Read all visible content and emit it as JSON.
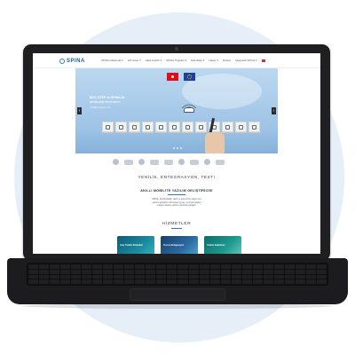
{
  "site": {
    "logo_text": "SPINA",
    "brand_color": "#1b5f9c",
    "accent_color": "#2a7fc4",
    "menu": [
      "SPINA Hakkında ▾",
      "Hizmetler ▾",
      "Vaka Analizi ▾",
      "SPINA Projeleri ▾",
      "Etkinlikler ▾",
      "Haber ▾",
      "İletişim",
      "Medyada SPINA ▾"
    ]
  },
  "hero": {
    "line1": "BOO-STEP ve SPINA ile",
    "line2": "yenilikçiliğe kendi adımı",
    "line3": "Yenilikçi projeler için",
    "prev_icon": "chevron-left-icon",
    "next_icon": "chevron-right-icon"
  },
  "main": {
    "tagline": "YENİLİK, ENTEGRASYON, TEST!",
    "section_title": "AKILLI MOBİLİTE YAZILIM GELİŞTİRİCİSİ",
    "body_lines": [
      "SPINA, Sürdürülebilir, akıllı ve güvenli bir ulaşım için",
      "yazılım geliştirme hizmetleri sunan, yeni teknolojileri",
      "entegre ederek yazılım çözümleri geliştirir."
    ],
    "services_title": "HİZMETLER",
    "cards": [
      {
        "label": "Araç Yazılım Sistemleri"
      },
      {
        "label": "Test ve Entegrasyon"
      },
      {
        "label": "Yazılım Geliştirme"
      }
    ]
  }
}
